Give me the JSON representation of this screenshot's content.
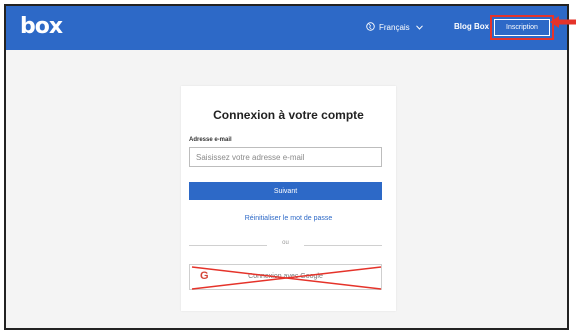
{
  "header": {
    "logo": "box",
    "language": "Français",
    "blog": "Blog Box",
    "signup": "Inscription"
  },
  "login": {
    "title": "Connexion à votre compte",
    "email_label": "Adresse e-mail",
    "email_placeholder": "Saisissez votre adresse e-mail",
    "next_button": "Suivant",
    "reset_link": "Réinitialiser le mot de passe",
    "or_text": "ou",
    "google_button": "Connexion avec Google",
    "google_icon_letter": "G"
  },
  "colors": {
    "brand_blue": "#2d69c7",
    "annotation_red": "#e5332a"
  },
  "icons": {
    "language": "globe-icon",
    "language_dropdown": "chevron-down-icon",
    "annotation": "arrow-left-icon",
    "strike": "cross-out-icon"
  }
}
